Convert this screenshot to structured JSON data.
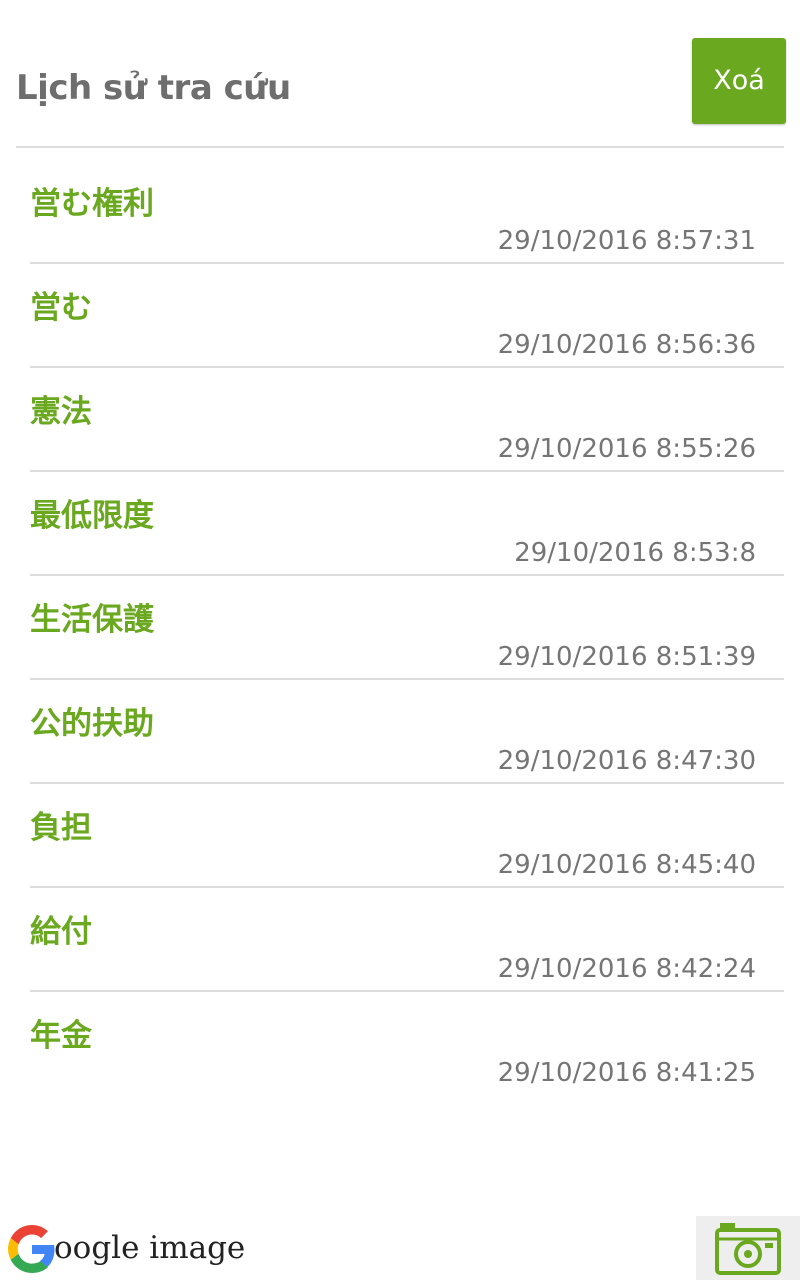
{
  "header": {
    "title": "Lịch sử tra cứu",
    "clear_label": "Xoá"
  },
  "history": [
    {
      "word": "営む権利",
      "time": "29/10/2016 8:57:31"
    },
    {
      "word": "営む",
      "time": "29/10/2016 8:56:36"
    },
    {
      "word": "憲法",
      "time": "29/10/2016 8:55:26"
    },
    {
      "word": "最低限度",
      "time": "29/10/2016 8:53:8"
    },
    {
      "word": "生活保護",
      "time": "29/10/2016 8:51:39"
    },
    {
      "word": "公的扶助",
      "time": "29/10/2016 8:47:30"
    },
    {
      "word": "負担",
      "time": "29/10/2016 8:45:40"
    },
    {
      "word": "給付",
      "time": "29/10/2016 8:42:24"
    },
    {
      "word": "年金",
      "time": "29/10/2016 8:41:25"
    }
  ],
  "footer": {
    "google_image_label": "oogle image",
    "google_icon": "google-g-icon",
    "camera_icon": "camera-icon"
  },
  "colors": {
    "accent": "#6aa820",
    "title": "#6e6e6e",
    "timestamp": "#757575",
    "divider": "#dcdcdc"
  }
}
